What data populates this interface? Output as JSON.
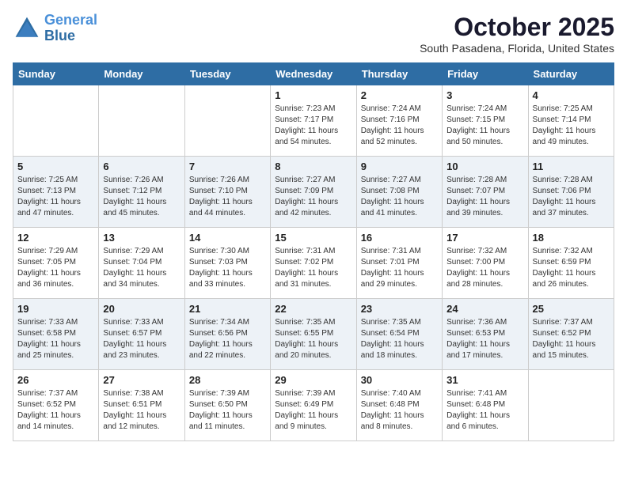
{
  "header": {
    "logo_line1": "General",
    "logo_line2": "Blue",
    "month": "October 2025",
    "location": "South Pasadena, Florida, United States"
  },
  "weekdays": [
    "Sunday",
    "Monday",
    "Tuesday",
    "Wednesday",
    "Thursday",
    "Friday",
    "Saturday"
  ],
  "weeks": [
    [
      {
        "num": "",
        "info": ""
      },
      {
        "num": "",
        "info": ""
      },
      {
        "num": "",
        "info": ""
      },
      {
        "num": "1",
        "info": "Sunrise: 7:23 AM\nSunset: 7:17 PM\nDaylight: 11 hours\nand 54 minutes."
      },
      {
        "num": "2",
        "info": "Sunrise: 7:24 AM\nSunset: 7:16 PM\nDaylight: 11 hours\nand 52 minutes."
      },
      {
        "num": "3",
        "info": "Sunrise: 7:24 AM\nSunset: 7:15 PM\nDaylight: 11 hours\nand 50 minutes."
      },
      {
        "num": "4",
        "info": "Sunrise: 7:25 AM\nSunset: 7:14 PM\nDaylight: 11 hours\nand 49 minutes."
      }
    ],
    [
      {
        "num": "5",
        "info": "Sunrise: 7:25 AM\nSunset: 7:13 PM\nDaylight: 11 hours\nand 47 minutes."
      },
      {
        "num": "6",
        "info": "Sunrise: 7:26 AM\nSunset: 7:12 PM\nDaylight: 11 hours\nand 45 minutes."
      },
      {
        "num": "7",
        "info": "Sunrise: 7:26 AM\nSunset: 7:10 PM\nDaylight: 11 hours\nand 44 minutes."
      },
      {
        "num": "8",
        "info": "Sunrise: 7:27 AM\nSunset: 7:09 PM\nDaylight: 11 hours\nand 42 minutes."
      },
      {
        "num": "9",
        "info": "Sunrise: 7:27 AM\nSunset: 7:08 PM\nDaylight: 11 hours\nand 41 minutes."
      },
      {
        "num": "10",
        "info": "Sunrise: 7:28 AM\nSunset: 7:07 PM\nDaylight: 11 hours\nand 39 minutes."
      },
      {
        "num": "11",
        "info": "Sunrise: 7:28 AM\nSunset: 7:06 PM\nDaylight: 11 hours\nand 37 minutes."
      }
    ],
    [
      {
        "num": "12",
        "info": "Sunrise: 7:29 AM\nSunset: 7:05 PM\nDaylight: 11 hours\nand 36 minutes."
      },
      {
        "num": "13",
        "info": "Sunrise: 7:29 AM\nSunset: 7:04 PM\nDaylight: 11 hours\nand 34 minutes."
      },
      {
        "num": "14",
        "info": "Sunrise: 7:30 AM\nSunset: 7:03 PM\nDaylight: 11 hours\nand 33 minutes."
      },
      {
        "num": "15",
        "info": "Sunrise: 7:31 AM\nSunset: 7:02 PM\nDaylight: 11 hours\nand 31 minutes."
      },
      {
        "num": "16",
        "info": "Sunrise: 7:31 AM\nSunset: 7:01 PM\nDaylight: 11 hours\nand 29 minutes."
      },
      {
        "num": "17",
        "info": "Sunrise: 7:32 AM\nSunset: 7:00 PM\nDaylight: 11 hours\nand 28 minutes."
      },
      {
        "num": "18",
        "info": "Sunrise: 7:32 AM\nSunset: 6:59 PM\nDaylight: 11 hours\nand 26 minutes."
      }
    ],
    [
      {
        "num": "19",
        "info": "Sunrise: 7:33 AM\nSunset: 6:58 PM\nDaylight: 11 hours\nand 25 minutes."
      },
      {
        "num": "20",
        "info": "Sunrise: 7:33 AM\nSunset: 6:57 PM\nDaylight: 11 hours\nand 23 minutes."
      },
      {
        "num": "21",
        "info": "Sunrise: 7:34 AM\nSunset: 6:56 PM\nDaylight: 11 hours\nand 22 minutes."
      },
      {
        "num": "22",
        "info": "Sunrise: 7:35 AM\nSunset: 6:55 PM\nDaylight: 11 hours\nand 20 minutes."
      },
      {
        "num": "23",
        "info": "Sunrise: 7:35 AM\nSunset: 6:54 PM\nDaylight: 11 hours\nand 18 minutes."
      },
      {
        "num": "24",
        "info": "Sunrise: 7:36 AM\nSunset: 6:53 PM\nDaylight: 11 hours\nand 17 minutes."
      },
      {
        "num": "25",
        "info": "Sunrise: 7:37 AM\nSunset: 6:52 PM\nDaylight: 11 hours\nand 15 minutes."
      }
    ],
    [
      {
        "num": "26",
        "info": "Sunrise: 7:37 AM\nSunset: 6:52 PM\nDaylight: 11 hours\nand 14 minutes."
      },
      {
        "num": "27",
        "info": "Sunrise: 7:38 AM\nSunset: 6:51 PM\nDaylight: 11 hours\nand 12 minutes."
      },
      {
        "num": "28",
        "info": "Sunrise: 7:39 AM\nSunset: 6:50 PM\nDaylight: 11 hours\nand 11 minutes."
      },
      {
        "num": "29",
        "info": "Sunrise: 7:39 AM\nSunset: 6:49 PM\nDaylight: 11 hours\nand 9 minutes."
      },
      {
        "num": "30",
        "info": "Sunrise: 7:40 AM\nSunset: 6:48 PM\nDaylight: 11 hours\nand 8 minutes."
      },
      {
        "num": "31",
        "info": "Sunrise: 7:41 AM\nSunset: 6:48 PM\nDaylight: 11 hours\nand 6 minutes."
      },
      {
        "num": "",
        "info": ""
      }
    ]
  ]
}
